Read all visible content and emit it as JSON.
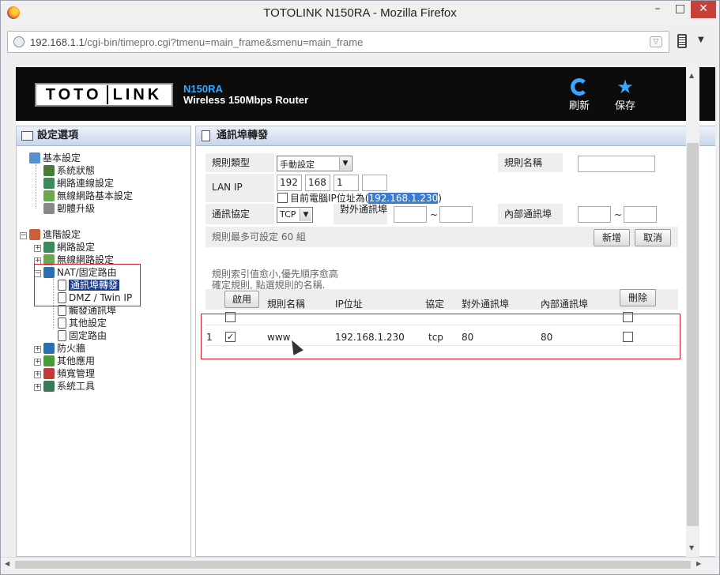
{
  "window": {
    "title": "TOTOLINK N150RA - Mozilla Firefox",
    "min": "–",
    "max": "□",
    "close": "✕"
  },
  "browser": {
    "url_host": "192.168.1.1",
    "url_path": "/cgi-bin/timepro.cgi?tmenu=main_frame&smenu=main_frame"
  },
  "header": {
    "logo_left": "TOTO",
    "logo_right": "LINK",
    "model": "N150RA",
    "model_sub": "Wireless 150Mbps Router",
    "refresh_label": "刷新",
    "save_label": "保存",
    "icons": {
      "refresh": "refresh-icon",
      "save": "star-icon"
    },
    "accent_color": "#3aa6ff"
  },
  "sidebar": {
    "title": "設定選項",
    "basic": {
      "label": "基本設定",
      "children": [
        "系統狀態",
        "網路連線設定",
        "無線網路基本設定",
        "韌體升級"
      ]
    },
    "advanced": {
      "label": "進階設定",
      "children": [
        "網路設定",
        "無線網路設定",
        "NAT/固定路由",
        "防火牆",
        "其他應用",
        "頻寬管理",
        "系統工具"
      ],
      "nat_children": [
        "通訊埠轉發",
        "DMZ / Twin IP",
        "觸發通訊埠",
        "其他設定",
        "固定路由"
      ]
    },
    "selected_color": "#1e3f8a"
  },
  "main": {
    "title": "通訊埠轉發",
    "form": {
      "rule_type_label": "規則類型",
      "rule_type_value": "手動設定",
      "rule_name_label": "規則名稱",
      "rule_name_value": "",
      "lan_ip_label": "LAN IP",
      "lan_ip": [
        "192",
        "168",
        "1",
        ""
      ],
      "current_ip_text": "目前電腦IP位址為(",
      "current_ip": "192.168.1.230",
      "current_ip_close": ")",
      "protocol_label": "通訊協定",
      "protocol_value": "TCP",
      "external_port_label": "對外通訊埠",
      "internal_port_label": "內部通訊埠",
      "range_sep": "~",
      "max_rules_note": "規則最多可設定 60 組",
      "add_button": "新增",
      "cancel_button": "取消"
    },
    "notes": [
      "規則索引值愈小,優先順序愈高",
      "確定規則, 點選規則的名稱."
    ],
    "table": {
      "enable_button": "啟用",
      "delete_button": "刪除",
      "headers": [
        "規則名稱",
        "IP位址",
        "協定",
        "對外通訊埠",
        "內部通訊埠"
      ],
      "rows": [
        {
          "index": "1",
          "enabled": "✓",
          "name": "www",
          "ip": "192.168.1.230",
          "protocol": "tcp",
          "external": "80",
          "internal": "80"
        }
      ]
    },
    "highlight_color": "#d21f2a"
  }
}
